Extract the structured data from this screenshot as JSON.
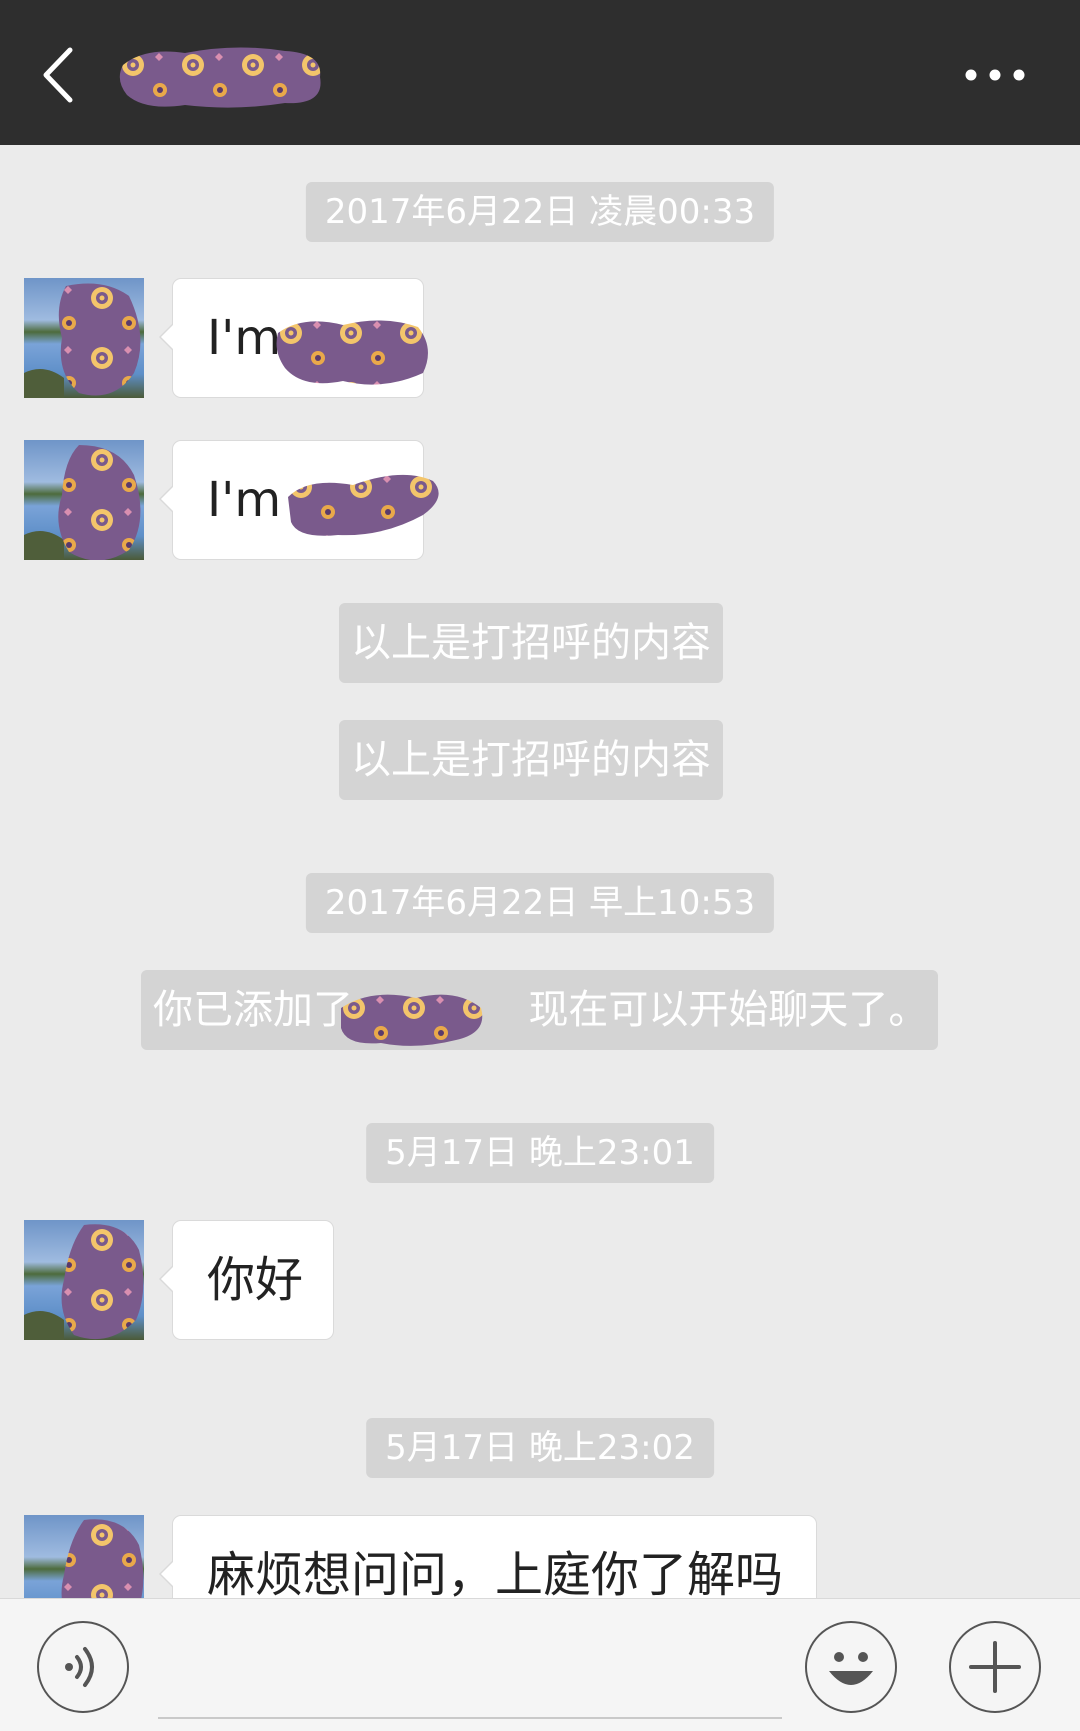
{
  "header": {
    "back_icon": "chevron-left-icon",
    "title": "",
    "more_icon": "more-horizontal-icon",
    "background": "#2e2e2e"
  },
  "messages": {
    "ts1": "2017年6月22日 凌晨00:33",
    "m1": "I'm",
    "m2": "I'm",
    "sys1": "以上是打招呼的内容",
    "sys2": "以上是打招呼的内容",
    "ts2": "2017年6月22日 早上10:53",
    "sys3_prefix": "你已添加了",
    "sys3_suffix": "现在可以开始聊天了。",
    "ts3": "5月17日 晚上23:01",
    "m3": "你好",
    "ts4": "5月17日 晚上23:02",
    "m4": "麻烦想问问，上庭你了解吗"
  },
  "bottom_bar": {
    "voice_icon": "voice-icon",
    "input_value": "",
    "emoji_icon": "emoji-icon",
    "plus_icon": "plus-icon"
  },
  "colors": {
    "bubble_bg": "#ffffff",
    "system_bg": "#d4d4d4",
    "background": "#ebebeb",
    "redaction": "#7a5a8c"
  }
}
